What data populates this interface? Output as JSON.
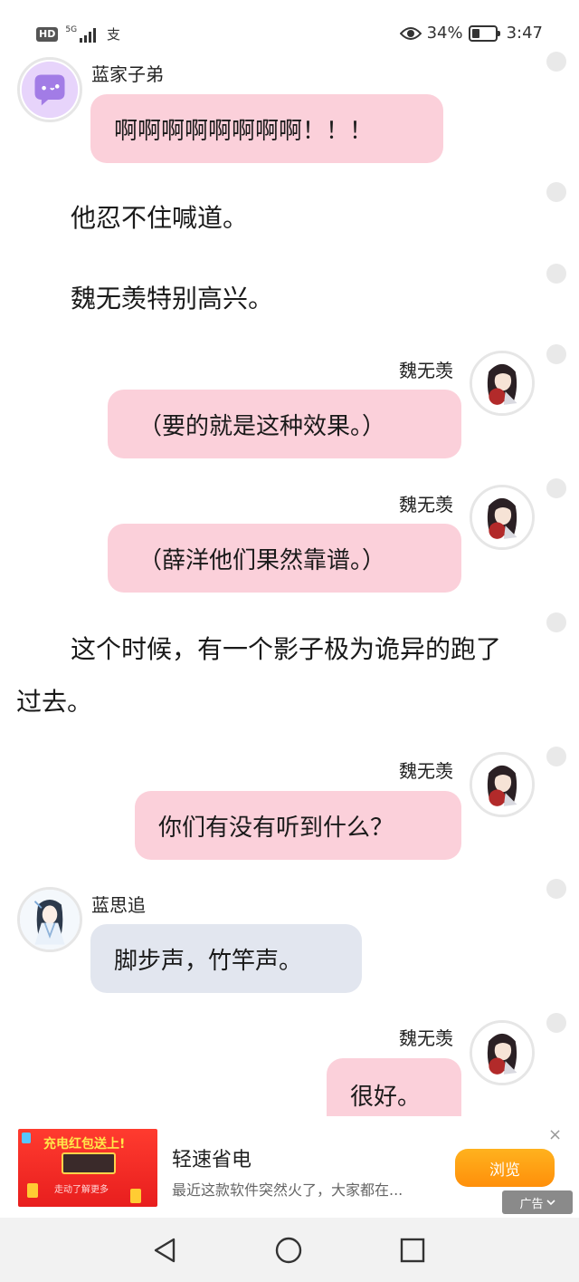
{
  "status_bar": {
    "hd": "HD",
    "network": "5G",
    "carrier_icon": "支",
    "battery_percent": "34%",
    "battery_level": 0.34,
    "time": "3:47"
  },
  "chat": {
    "msg1": {
      "speaker": "蓝家子弟",
      "text": "啊啊啊啊啊啊啊啊！！！",
      "avatar": "chat-bubble-avatar"
    },
    "narr1": "他忍不住喊道。",
    "narr2": "魏无羡特别高兴。",
    "msg2": {
      "speaker": "魏无羡",
      "text": "（要的就是这种效果。）",
      "avatar": "wei-wuxian-avatar"
    },
    "msg3": {
      "speaker": "魏无羡",
      "text": "（薛洋他们果然靠谱。）",
      "avatar": "wei-wuxian-avatar"
    },
    "narr3_line1": "这个时候，有一个影子极为诡异的跑了",
    "narr3_line2": "过去。",
    "msg4": {
      "speaker": "魏无羡",
      "text": "你们有没有听到什么？",
      "avatar": "wei-wuxian-avatar"
    },
    "msg5": {
      "speaker": "蓝思追",
      "text": "脚步声，竹竿声。",
      "avatar": "lan-sizhui-avatar"
    },
    "msg6": {
      "speaker": "魏无羡",
      "text": "很好。",
      "avatar": "wei-wuxian-avatar"
    }
  },
  "ad": {
    "thumb_headline": "充电红包送上!",
    "thumb_sub": "走动了解更多",
    "title": "轻速省电",
    "description": "最近这款软件突然火了，大家都在...",
    "button": "浏览",
    "close": "×",
    "tag": "广告"
  },
  "nav": {
    "back_icon": "back-triangle-icon",
    "home_icon": "home-circle-icon",
    "recents_icon": "recents-square-icon"
  },
  "colors": {
    "bubble_pink": "#fbd0da",
    "bubble_gray": "#e2e6ef",
    "ad_button": "#ff9a12"
  }
}
